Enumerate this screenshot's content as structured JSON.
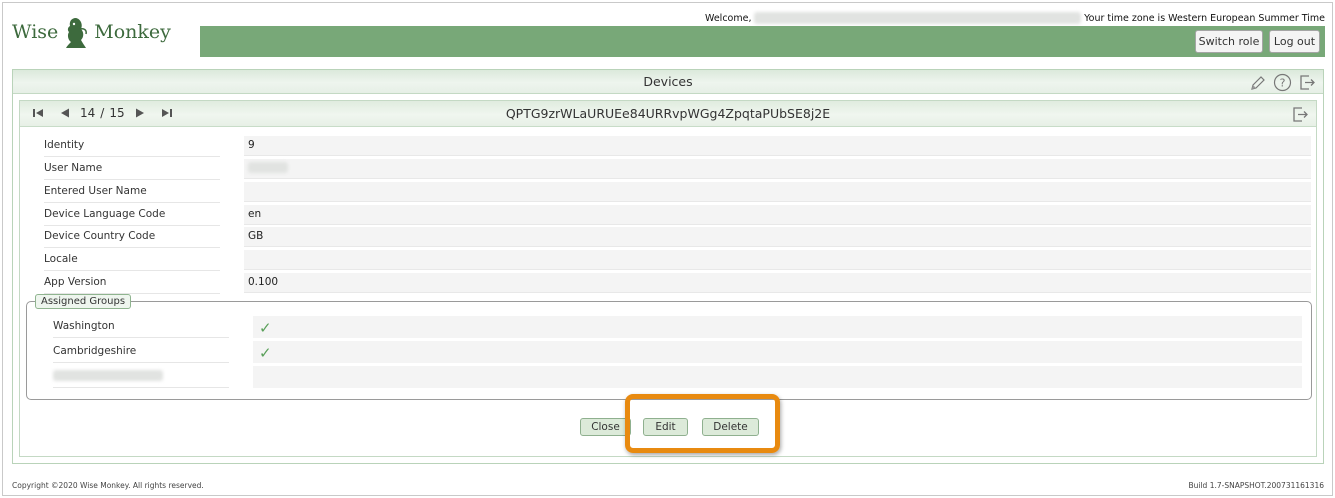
{
  "header": {
    "logo_word_left": "Wise",
    "logo_word_right": "Monkey",
    "welcome_label": "Welcome,",
    "timezone_text": "Your time zone is Western European Summer Time",
    "switch_role_label": "Switch role",
    "log_out_label": "Log out"
  },
  "panel": {
    "title": "Devices",
    "icons": [
      "pencil-icon",
      "help-icon",
      "export-icon"
    ]
  },
  "record": {
    "pager_current": "14",
    "pager_separator": "/",
    "pager_total": "15",
    "title": "QPTG9zrWLaURUEe84URRvpWGg4ZpqtaPUbSE8j2E"
  },
  "fields": [
    {
      "label": "Identity",
      "value": "9"
    },
    {
      "label": "User Name",
      "value": ""
    },
    {
      "label": "Entered User Name",
      "value": ""
    },
    {
      "label": "Device Language Code",
      "value": "en"
    },
    {
      "label": "Device Country Code",
      "value": "GB"
    },
    {
      "label": "Locale",
      "value": ""
    },
    {
      "label": "App Version",
      "value": "0.100"
    }
  ],
  "assigned_groups": {
    "legend": "Assigned Groups",
    "groups": [
      {
        "label": "Washington",
        "checked": true
      },
      {
        "label": "Cambridgeshire",
        "checked": true
      },
      {
        "label": "",
        "checked": false
      }
    ]
  },
  "actions": {
    "close_label": "Close",
    "edit_label": "Edit",
    "delete_label": "Delete"
  },
  "footer": {
    "copyright": "Copyright ©2020 Wise Monkey. All rights reserved.",
    "build": "Build 1.7-SNAPSHOT.200731161316"
  },
  "colors": {
    "brand_green": "#78a878",
    "highlight_orange": "#e88a10",
    "check_green": "#5aa05a"
  }
}
